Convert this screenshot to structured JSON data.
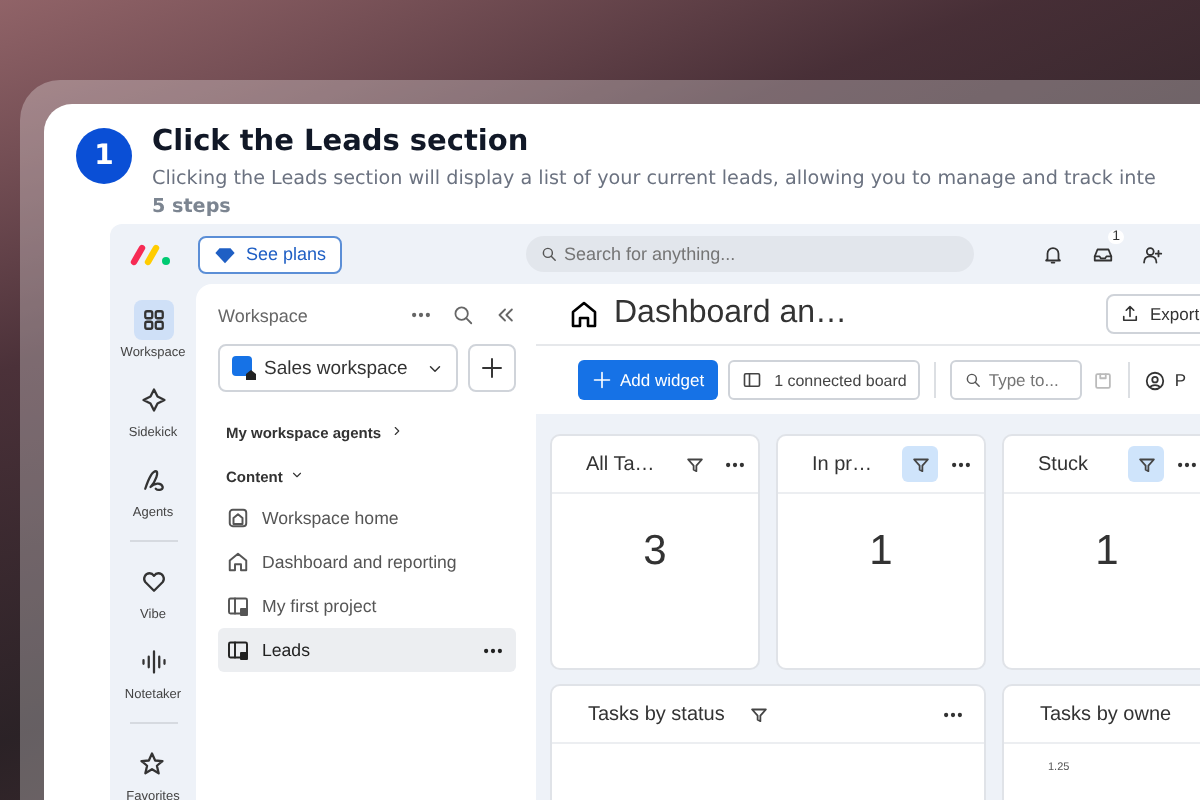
{
  "step": {
    "number": "1",
    "title": "Click the Leads section",
    "description": "Clicking the Leads section will display a list of your current leads, allowing you to manage and track inte",
    "count": "5 steps"
  },
  "top_bar": {
    "plan_button": "See plans",
    "search_placeholder": "Search for anything...",
    "inbox_badge": "1"
  },
  "rail": [
    {
      "kind": "workspace",
      "label": "Workspace",
      "selected": true
    },
    {
      "kind": "sidekick",
      "label": "Sidekick",
      "selected": false
    },
    {
      "kind": "agents",
      "label": "Agents",
      "selected": false
    },
    {
      "kind": "vibe",
      "label": "Vibe",
      "selected": false
    },
    {
      "kind": "notetaker",
      "label": "Notetaker",
      "selected": false
    },
    {
      "kind": "favorites",
      "label": "Favorites",
      "selected": false
    }
  ],
  "sidebar": {
    "title": "Workspace",
    "workspace": "Sales workspace",
    "agents_link": "My workspace agents",
    "section": "Content",
    "items": [
      {
        "kind": "home",
        "label": "Workspace home",
        "selected": false
      },
      {
        "kind": "dashboard",
        "label": "Dashboard and reporting",
        "selected": false
      },
      {
        "kind": "board",
        "label": "My first project",
        "selected": false
      },
      {
        "kind": "board",
        "label": "Leads",
        "selected": true
      }
    ]
  },
  "dashboard": {
    "title": "Dashboard an…",
    "export_button": "Export",
    "add_widget_button": "Add widget",
    "connected_button": "1 connected board",
    "search_placeholder": "Type to...",
    "people_button": "P",
    "counters": [
      {
        "title": "All Ta…",
        "value": "3",
        "filter_active": false
      },
      {
        "title": "In pr…",
        "value": "1",
        "filter_active": true
      },
      {
        "title": "Stuck",
        "value": "1",
        "filter_active": true
      }
    ],
    "widgets": [
      {
        "title": "Tasks by status"
      },
      {
        "title": "Tasks by owne",
        "axis_label": "1.25"
      }
    ]
  }
}
